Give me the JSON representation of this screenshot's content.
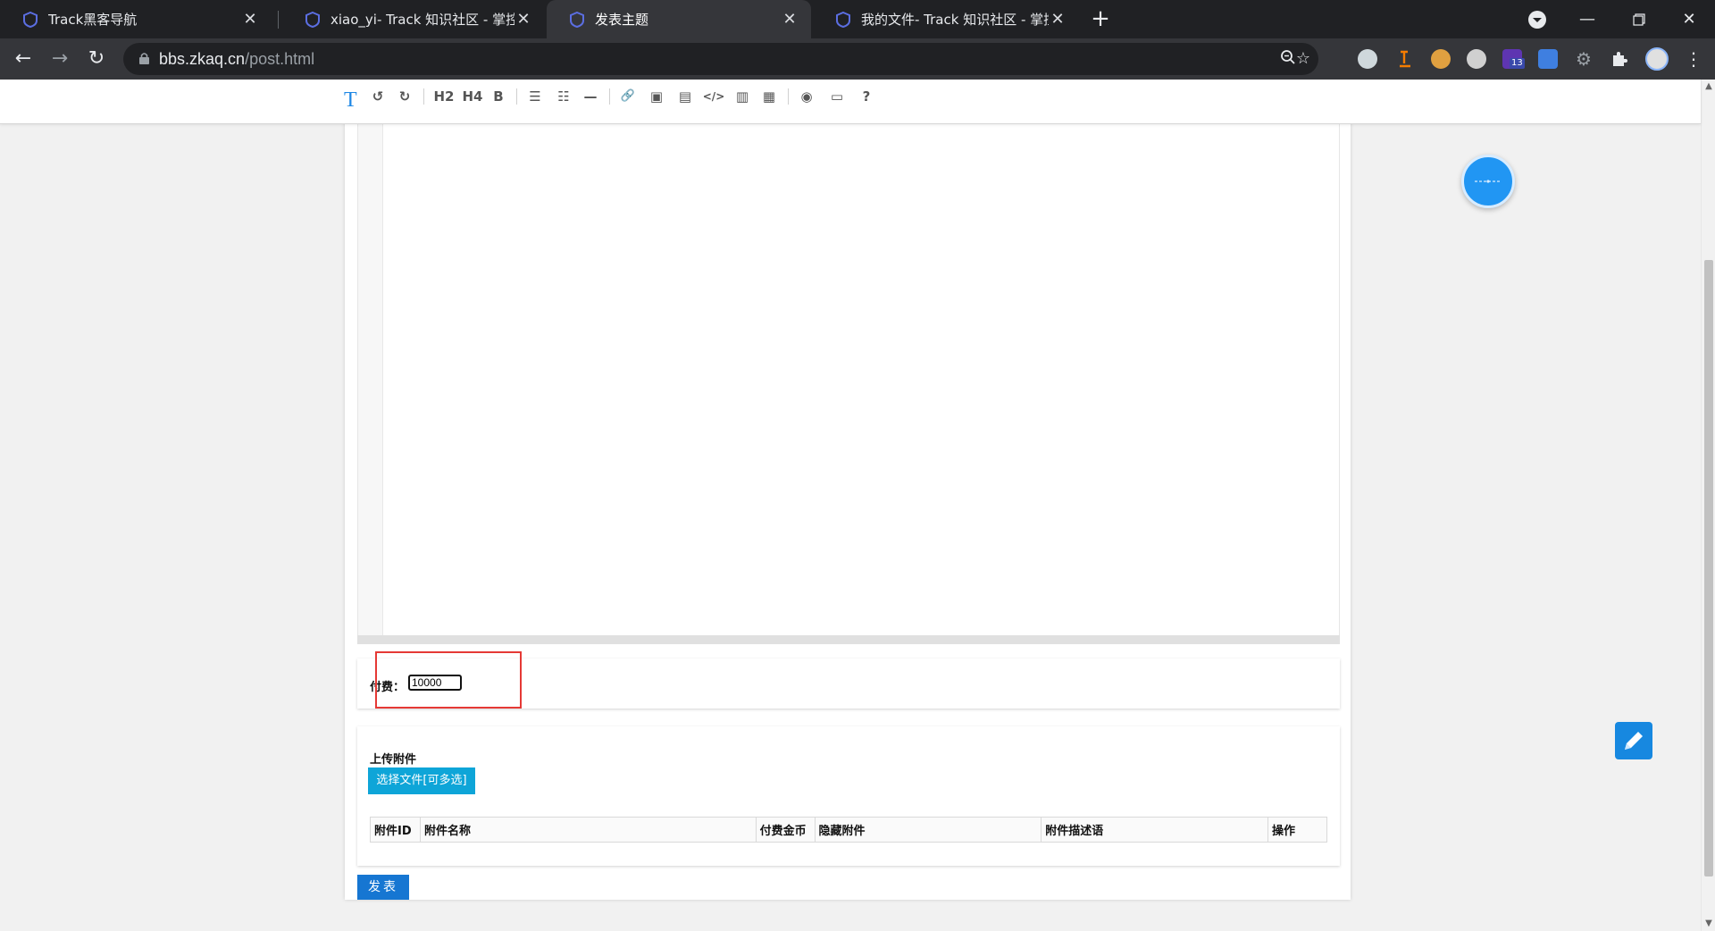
{
  "browser": {
    "tabs": [
      {
        "title": "Track黑客导航",
        "active": false
      },
      {
        "title": "xiao_yi- Track 知识社区 - 掌控安",
        "active": false
      },
      {
        "title": "发表主题",
        "active": true
      },
      {
        "title": "我的文件- Track 知识社区 - 掌控",
        "active": false
      }
    ],
    "url_domain": "bbs.zkaq.cn",
    "url_path": "/post.html",
    "extension_badge": "13"
  },
  "editor": {
    "logo_letter": "T",
    "toolbar": {
      "undo": "↺",
      "redo": "↻",
      "h2": "H2",
      "h4": "H4",
      "bold": "B",
      "ul": "☰",
      "ol": "☷",
      "hr": "—",
      "link": "🔗",
      "image": "▣",
      "images": "▤",
      "code": "</>",
      "file": "▥",
      "table": "▦",
      "preview": "◉",
      "fullscreen": "▭",
      "help": "?"
    }
  },
  "fee": {
    "label": "付费：",
    "value": "10000"
  },
  "upload": {
    "title": "上传附件",
    "choose_button": "选择文件[可多选]",
    "columns": [
      "附件ID",
      "附件名称",
      "付费金币",
      "隐藏附件",
      "附件描述语",
      "操作"
    ]
  },
  "publish_button": "发表",
  "colors": {
    "accent": "#1676d2",
    "upload_button": "#0ea5d8",
    "highlight": "#e53935"
  }
}
